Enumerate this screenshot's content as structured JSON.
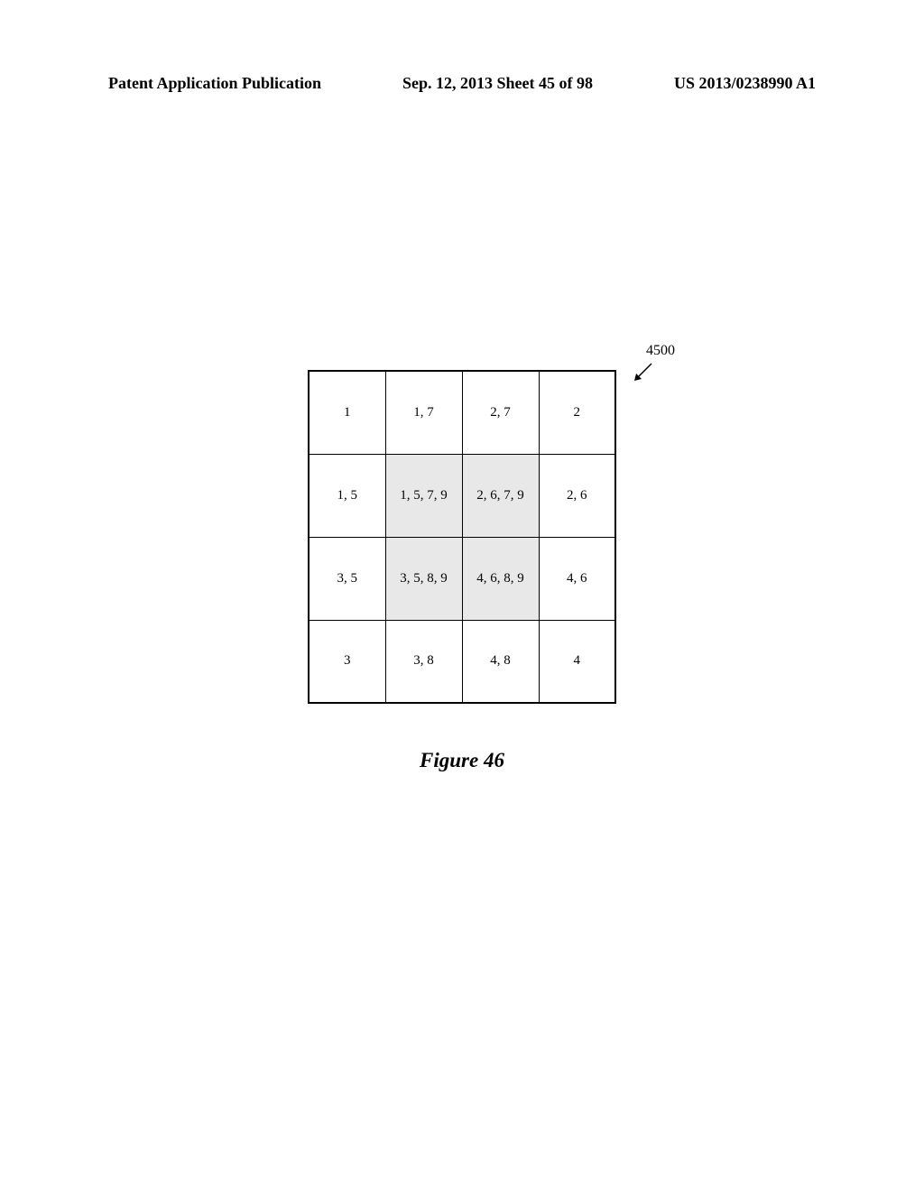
{
  "header": {
    "publication_type": "Patent Application Publication",
    "date_sheet": "Sep. 12, 2013  Sheet 45 of 98",
    "publication_number": "US 2013/0238990 A1"
  },
  "reference_number": "4500",
  "grid": {
    "rows": [
      {
        "cells": [
          {
            "value": "1",
            "shaded": false
          },
          {
            "value": "1, 7",
            "shaded": false
          },
          {
            "value": "2, 7",
            "shaded": false
          },
          {
            "value": "2",
            "shaded": false
          }
        ]
      },
      {
        "cells": [
          {
            "value": "1, 5",
            "shaded": false
          },
          {
            "value": "1, 5, 7, 9",
            "shaded": true
          },
          {
            "value": "2, 6, 7, 9",
            "shaded": true
          },
          {
            "value": "2, 6",
            "shaded": false
          }
        ]
      },
      {
        "cells": [
          {
            "value": "3, 5",
            "shaded": false
          },
          {
            "value": "3, 5, 8, 9",
            "shaded": true
          },
          {
            "value": "4, 6, 8, 9",
            "shaded": true
          },
          {
            "value": "4, 6",
            "shaded": false
          }
        ]
      },
      {
        "cells": [
          {
            "value": "3",
            "shaded": false
          },
          {
            "value": "3, 8",
            "shaded": false
          },
          {
            "value": "4, 8",
            "shaded": false
          },
          {
            "value": "4",
            "shaded": false
          }
        ]
      }
    ]
  },
  "figure_caption": "Figure 46"
}
